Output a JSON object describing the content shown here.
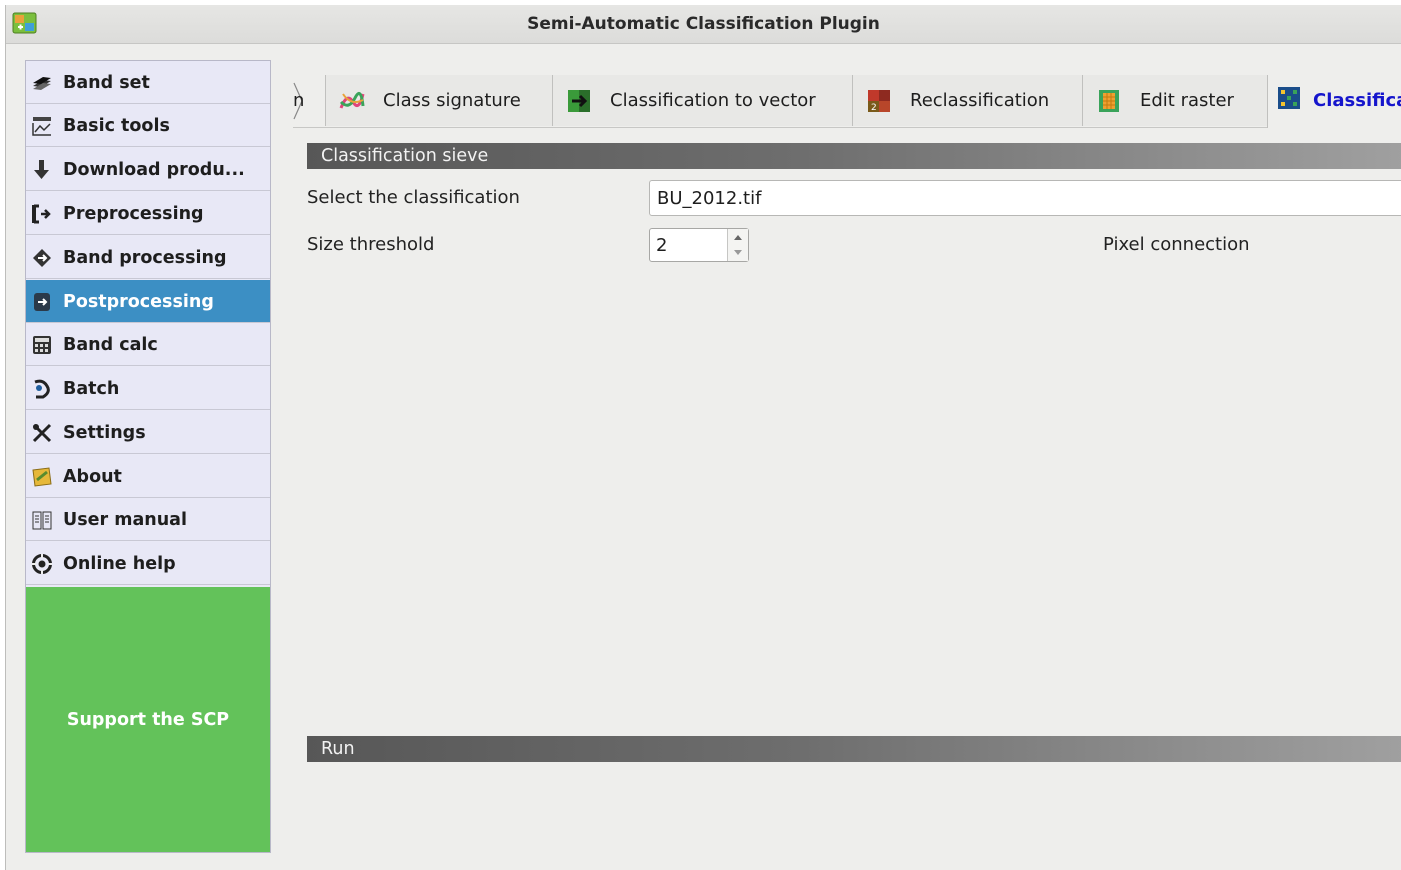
{
  "window": {
    "title": "Semi-Automatic Classification Plugin"
  },
  "sidebar": {
    "items": [
      {
        "label": "Band set",
        "icon": "band-set-icon"
      },
      {
        "label": "Basic tools",
        "icon": "basic-tools-icon"
      },
      {
        "label": "Download produ...",
        "icon": "download-icon"
      },
      {
        "label": "Preprocessing",
        "icon": "preprocessing-icon"
      },
      {
        "label": "Band processing",
        "icon": "band-processing-icon"
      },
      {
        "label": "Postprocessing",
        "icon": "postprocessing-icon",
        "active": true
      },
      {
        "label": "Band calc",
        "icon": "calculator-icon"
      },
      {
        "label": "Batch",
        "icon": "batch-icon"
      },
      {
        "label": "Settings",
        "icon": "settings-icon"
      },
      {
        "label": "About",
        "icon": "about-icon"
      },
      {
        "label": "User manual",
        "icon": "manual-icon"
      },
      {
        "label": "Online help",
        "icon": "help-icon"
      }
    ],
    "support_label": "Support the SCP"
  },
  "tabs": {
    "partial_label": "n",
    "items": [
      {
        "label": "Class signature",
        "icon": "class-signature-icon"
      },
      {
        "label": "Classification to vector",
        "icon": "classification-to-vector-icon"
      },
      {
        "label": "Reclassification",
        "icon": "reclassification-icon"
      },
      {
        "label": "Edit raster",
        "icon": "edit-raster-icon"
      },
      {
        "label": "Classifica",
        "icon": "classification-sieve-icon",
        "active": true
      }
    ]
  },
  "sieve": {
    "header": "Classification sieve",
    "select_label": "Select the classification",
    "selected_classification": "BU_2012.tif",
    "size_label": "Size threshold",
    "size_value": "2",
    "pixel_connection_label": "Pixel connection"
  },
  "run": {
    "header": "Run"
  },
  "colors": {
    "active_nav": "#3c8fc4",
    "support": "#63c25a",
    "active_tab_text": "#1515cc"
  }
}
